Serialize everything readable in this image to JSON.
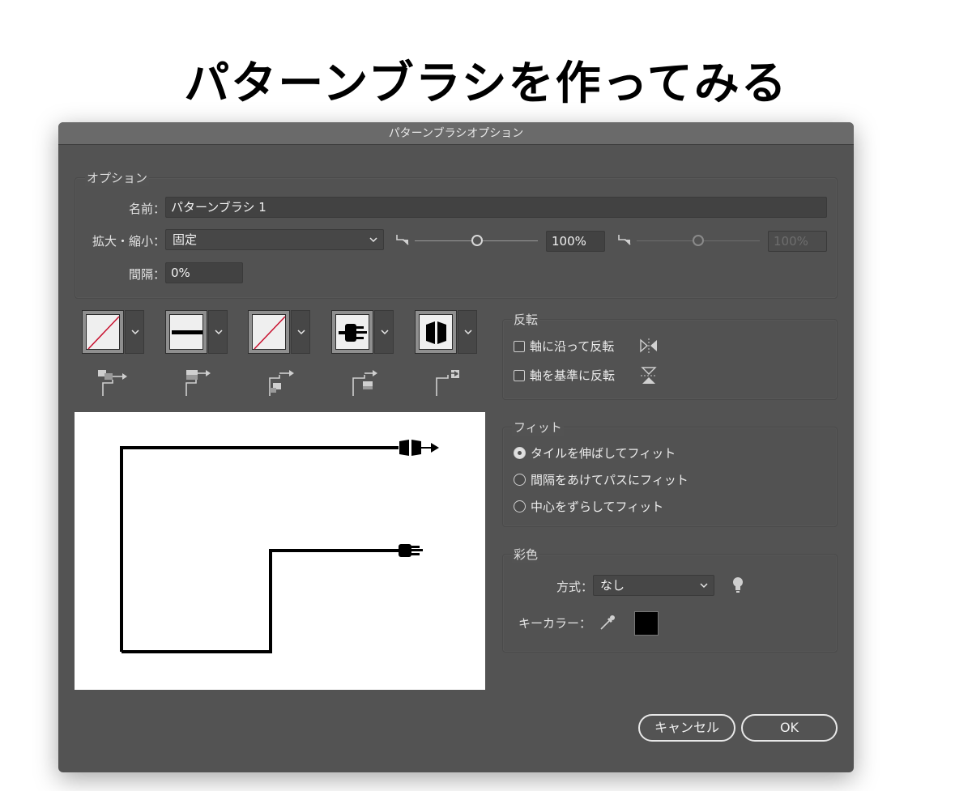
{
  "page_heading": "パターンブラシを作ってみる",
  "dialog": {
    "title": "パターンブラシオプション",
    "options_group": {
      "title": "オプション",
      "name_label": "名前：",
      "name_value": "パターンブラシ 1",
      "scale_label": "拡大・縮小：",
      "scale_value": "固定",
      "scale_percent": "100%",
      "scale_percent_max": "100%",
      "spacing_label": "間隔：",
      "spacing_value": "0%"
    },
    "flip_group": {
      "title": "反転",
      "along": "軸に沿って反転",
      "across": "軸を基準に反転"
    },
    "fit_group": {
      "title": "フィット",
      "options": [
        "タイルを伸ばしてフィット",
        "間隔をあけてパスにフィット",
        "中心をずらしてフィット"
      ],
      "selected_index": 0
    },
    "colorization_group": {
      "title": "彩色",
      "method_label": "方式：",
      "method_value": "なし",
      "key_color_label": "キーカラー：",
      "key_color": "#000000"
    },
    "buttons": {
      "cancel": "キャンセル",
      "ok": "OK"
    },
    "tiles": [
      {
        "name": "side-tile",
        "kind": "none"
      },
      {
        "name": "outer-corner-tile",
        "kind": "line"
      },
      {
        "name": "inner-corner-tile",
        "kind": "none"
      },
      {
        "name": "start-tile",
        "kind": "plug"
      },
      {
        "name": "end-tile",
        "kind": "socket"
      }
    ],
    "colors": {
      "dialog_bg": "#535353",
      "preview_bg": "#ffffff",
      "none_slash": "#c8102e"
    }
  }
}
